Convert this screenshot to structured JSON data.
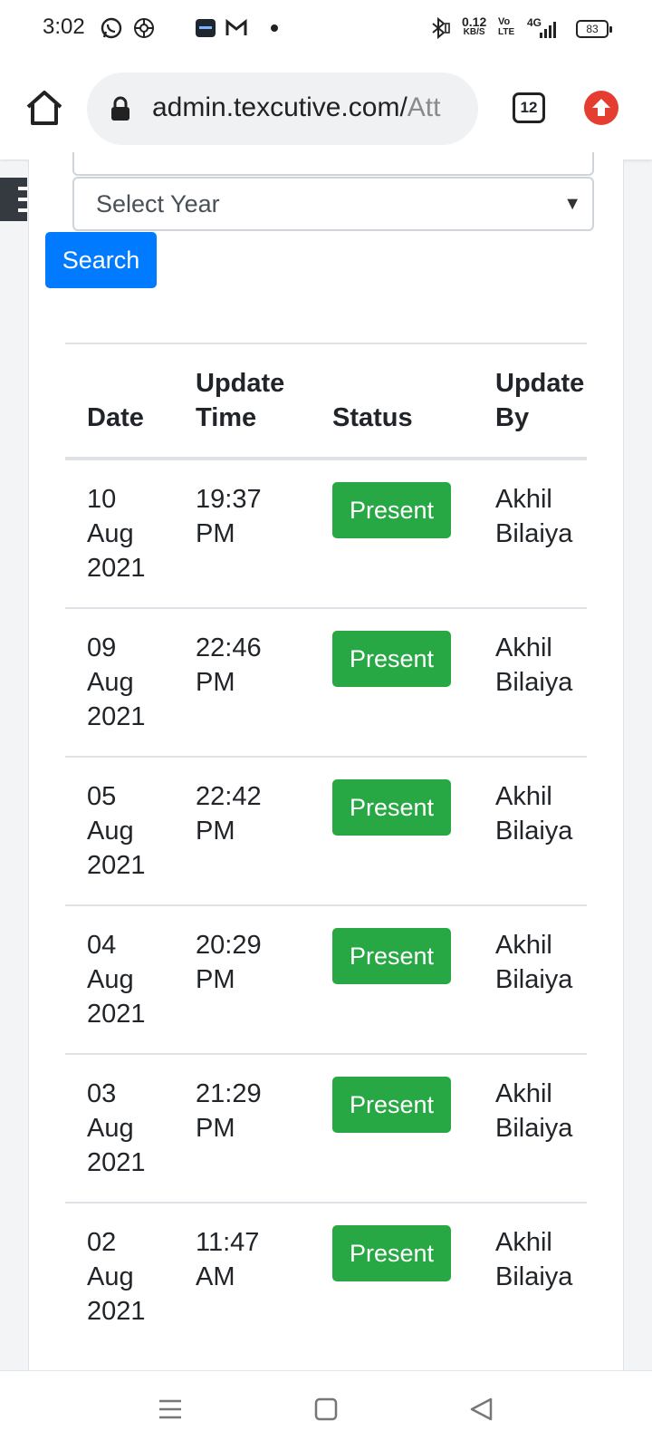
{
  "status_bar": {
    "time": "3:02",
    "net_speed_value": "0.12",
    "net_speed_unit": "KB/S",
    "volte_top": "Vo",
    "volte_bottom": "LTE",
    "network": "4G",
    "battery": "83"
  },
  "browser": {
    "url_main": "admin.texcutive.com/",
    "url_fade": "Att",
    "tab_count": "12"
  },
  "filters": {
    "year_placeholder": "Select Year",
    "search_label": "Search"
  },
  "table": {
    "headers": {
      "date": "Date",
      "update_time_line1": "Update",
      "update_time_line2": "Time",
      "status": "Status",
      "update_by_line1": "Update",
      "update_by_line2": "By"
    },
    "rows": [
      {
        "day": "10",
        "month": "Aug",
        "year": "2021",
        "time": "19:37",
        "ampm": "PM",
        "status": "Present",
        "first": "Akhil",
        "last": "Bilaiya"
      },
      {
        "day": "09",
        "month": "Aug",
        "year": "2021",
        "time": "22:46",
        "ampm": "PM",
        "status": "Present",
        "first": "Akhil",
        "last": "Bilaiya"
      },
      {
        "day": "05",
        "month": "Aug",
        "year": "2021",
        "time": "22:42",
        "ampm": "PM",
        "status": "Present",
        "first": "Akhil",
        "last": "Bilaiya"
      },
      {
        "day": "04",
        "month": "Aug",
        "year": "2021",
        "time": "20:29",
        "ampm": "PM",
        "status": "Present",
        "first": "Akhil",
        "last": "Bilaiya"
      },
      {
        "day": "03",
        "month": "Aug",
        "year": "2021",
        "time": "21:29",
        "ampm": "PM",
        "status": "Present",
        "first": "Akhil",
        "last": "Bilaiya"
      },
      {
        "day": "02",
        "month": "Aug",
        "year": "2021",
        "time": "11:47",
        "ampm": "AM",
        "status": "Present",
        "first": "Akhil",
        "last": "Bilaiya"
      }
    ]
  },
  "colors": {
    "primary": "#007bff",
    "success": "#28a745",
    "update_badge": "#e53d2f"
  }
}
